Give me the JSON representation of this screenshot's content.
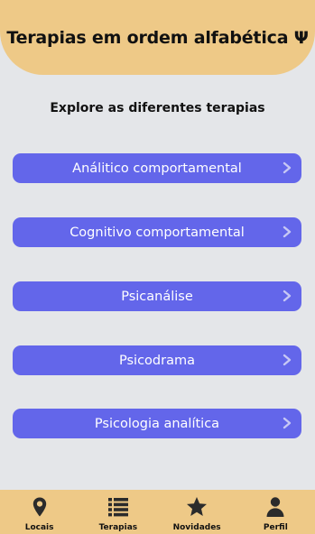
{
  "header": {
    "title": "Terapias em ordem alfabética Ψ"
  },
  "subtitle": "Explore as diferentes terapias",
  "therapies": [
    {
      "label": "Análitico comportamental"
    },
    {
      "label": "Cognitivo comportamental"
    },
    {
      "label": "Psicanálise"
    },
    {
      "label": "Psicodrama"
    },
    {
      "label": "Psicologia analítica"
    }
  ],
  "nav": {
    "items": [
      {
        "label": "Locais",
        "icon": "location-pin-icon"
      },
      {
        "label": "Terapias",
        "icon": "list-icon"
      },
      {
        "label": "Novidades",
        "icon": "star-icon"
      },
      {
        "label": "Perfil",
        "icon": "user-icon"
      }
    ]
  },
  "colors": {
    "header_bg": "#eec987",
    "page_bg": "#e4e6e9",
    "button_bg": "#6366ea",
    "button_text": "#ffffff",
    "chevron": "#c7c8f4"
  }
}
